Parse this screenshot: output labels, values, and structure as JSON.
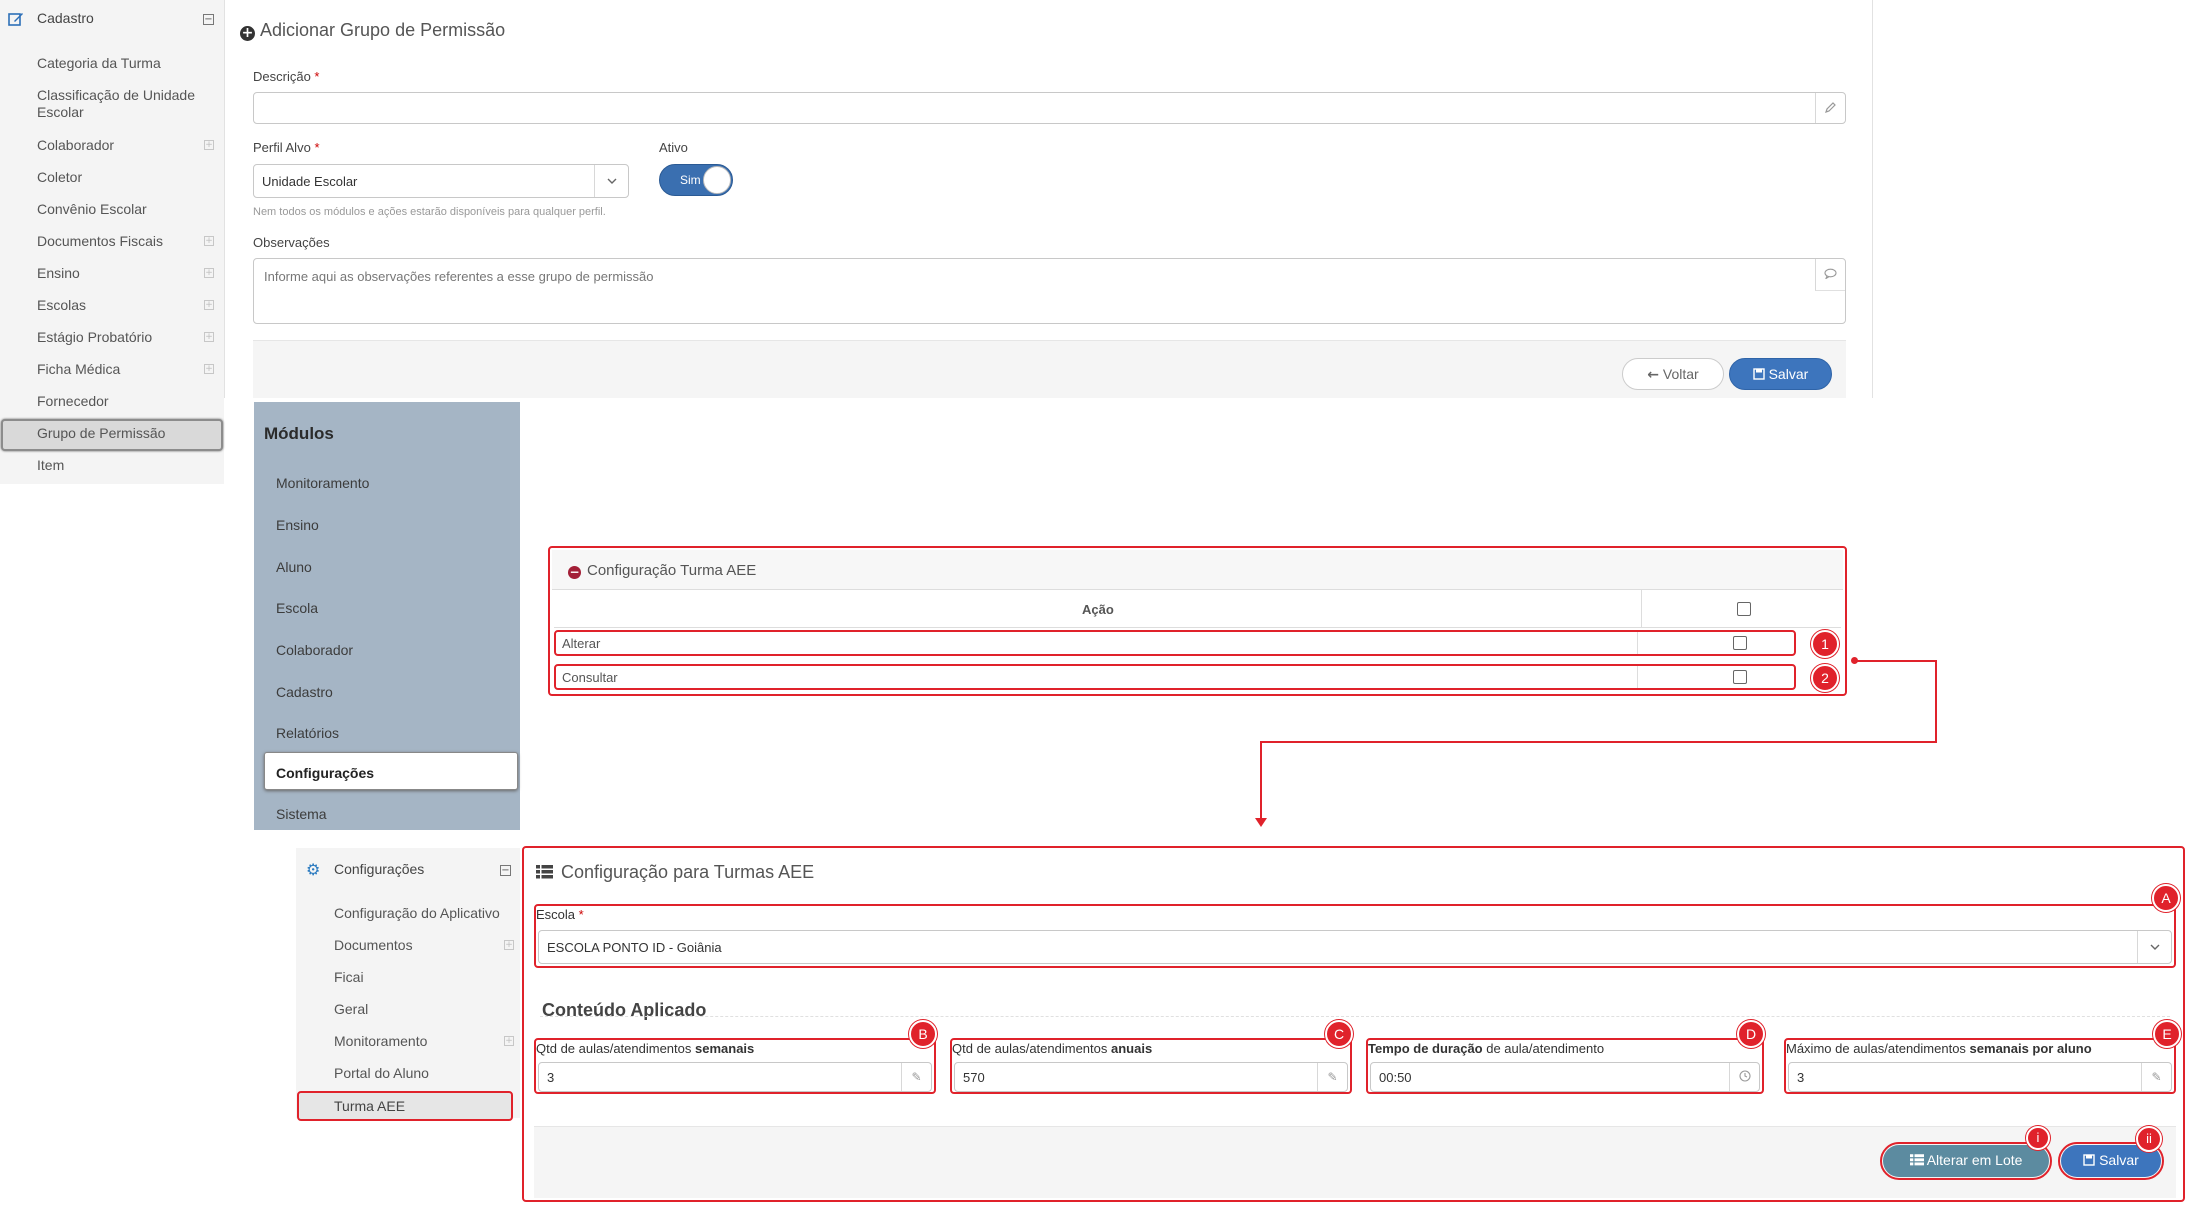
{
  "sidebar": {
    "header": "Cadastro",
    "items": [
      {
        "label": "Categoria da Turma"
      },
      {
        "label": "Classificação de Unidade Escolar"
      },
      {
        "label": "Colaborador"
      },
      {
        "label": "Coletor"
      },
      {
        "label": "Convênio Escolar"
      },
      {
        "label": "Documentos Fiscais"
      },
      {
        "label": "Ensino"
      },
      {
        "label": "Escolas"
      },
      {
        "label": "Estágio Probatório"
      },
      {
        "label": "Ficha Médica"
      },
      {
        "label": "Fornecedor"
      },
      {
        "label": "Grupo de Permissão"
      },
      {
        "label": "Item"
      }
    ]
  },
  "form": {
    "title": "Adicionar Grupo de Permissão",
    "descricao_label": "Descrição",
    "descricao_value": "",
    "required_mark": "*",
    "perfil_label": "Perfil Alvo",
    "perfil_value": "Unidade Escolar",
    "perfil_hint": "Nem todos os módulos e ações estarão disponíveis para qualquer perfil.",
    "ativo_label": "Ativo",
    "ativo_value": "Sim",
    "observacoes_label": "Observações",
    "observacoes_placeholder": "Informe aqui as observações referentes a esse grupo de permissão",
    "voltar_label": "Voltar",
    "salvar_label": "Salvar"
  },
  "modulos": {
    "title": "Módulos",
    "items": [
      {
        "label": "Monitoramento"
      },
      {
        "label": "Ensino"
      },
      {
        "label": "Aluno"
      },
      {
        "label": "Escola"
      },
      {
        "label": "Colaborador"
      },
      {
        "label": "Cadastro"
      },
      {
        "label": "Relatórios"
      },
      {
        "label": "Configurações"
      },
      {
        "label": "Sistema"
      }
    ],
    "selected": "Configurações"
  },
  "turma_table": {
    "title": "Configuração Turma AEE",
    "column_header": "Ação",
    "rows": [
      {
        "label": "Alterar",
        "badge": "1"
      },
      {
        "label": "Consultar",
        "badge": "2"
      }
    ]
  },
  "config_sidebar": {
    "header": "Configurações",
    "items": [
      {
        "label": "Configuração do Aplicativo"
      },
      {
        "label": "Documentos"
      },
      {
        "label": "Ficai"
      },
      {
        "label": "Geral"
      },
      {
        "label": "Monitoramento"
      },
      {
        "label": "Portal do Aluno"
      },
      {
        "label": "Turma AEE"
      }
    ],
    "selected": "Turma AEE"
  },
  "config_panel": {
    "title": "Configuração para Turmas AEE",
    "escola_label": "Escola",
    "escola_value": "ESCOLA PONTO ID - Goiânia",
    "section_title": "Conteúdo Aplicado",
    "fields": [
      {
        "label_pre": "Qtd de aulas/atendimentos ",
        "label_bold": "semanais",
        "label_post": "",
        "value": "3",
        "badge": "B"
      },
      {
        "label_pre": "Qtd de aulas/atendimentos ",
        "label_bold": "anuais",
        "label_post": "",
        "value": "570",
        "badge": "C"
      },
      {
        "label_pre": "",
        "label_bold": "Tempo de duração",
        "label_post": " de aula/atendimento",
        "value": "00:50",
        "badge": "D"
      },
      {
        "label_pre": "Máximo de aulas/atendimentos ",
        "label_bold": "semanais por aluno",
        "label_post": "",
        "value": "3",
        "badge": "E"
      }
    ],
    "badge_escola": "A",
    "alterar_lote_label": "Alterar em Lote",
    "salvar_label": "Salvar",
    "badge_lote": "i",
    "badge_salvar": "ii"
  },
  "colors": {
    "annotation_red": "#e0222b",
    "primary_blue": "#3d75bd",
    "modules_bg": "#a5b5c5"
  }
}
